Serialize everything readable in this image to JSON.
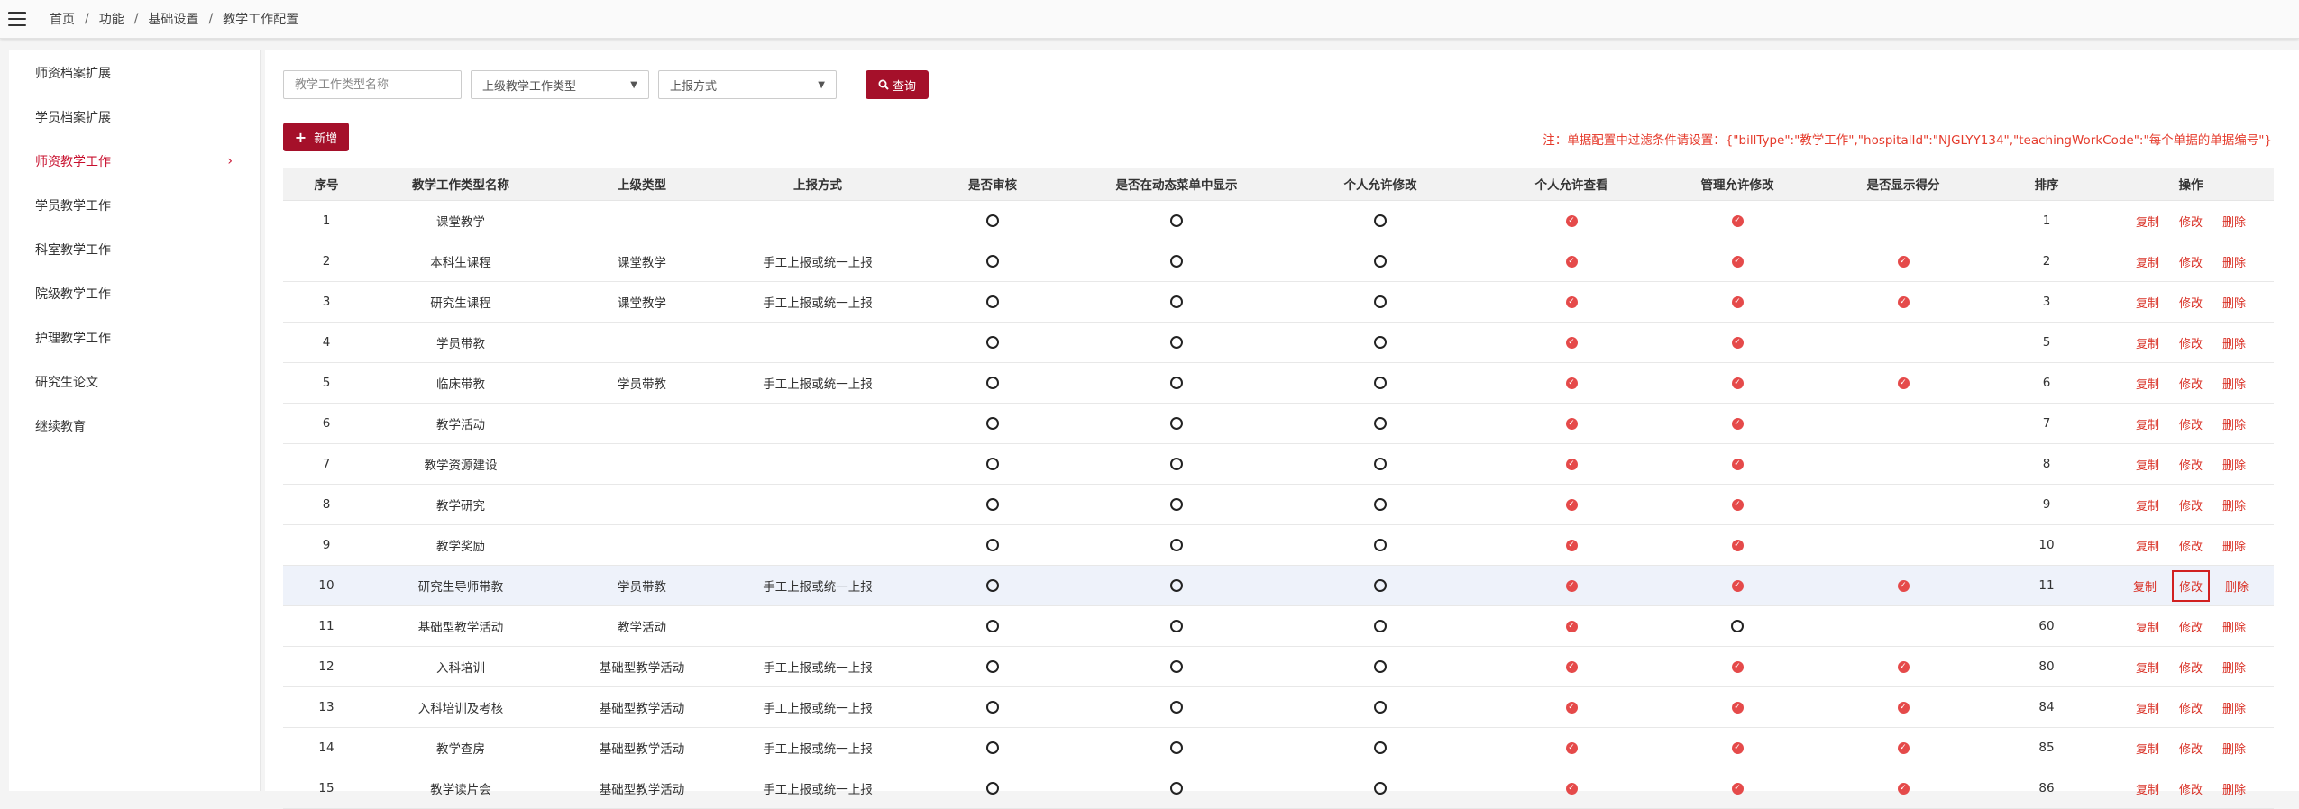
{
  "breadcrumb": [
    "首页",
    "功能",
    "基础设置",
    "教学工作配置"
  ],
  "sidebar": {
    "items": [
      {
        "label": "师资档案扩展",
        "active": false
      },
      {
        "label": "学员档案扩展",
        "active": false
      },
      {
        "label": "师资教学工作",
        "active": true
      },
      {
        "label": "学员教学工作",
        "active": false
      },
      {
        "label": "科室教学工作",
        "active": false
      },
      {
        "label": "院级教学工作",
        "active": false
      },
      {
        "label": "护理教学工作",
        "active": false
      },
      {
        "label": "研究生论文",
        "active": false
      },
      {
        "label": "继续教育",
        "active": false
      }
    ],
    "active_chevron": "›"
  },
  "filters": {
    "name_placeholder": "教学工作类型名称",
    "parent_type": "上级教学工作类型",
    "report_method": "上报方式",
    "query_label": "查询"
  },
  "add_label": "新增",
  "note": "注：单据配置中过滤条件请设置：{\"billType\":\"教学工作\",\"hospitalId\":\"NJGLYY134\",\"teachingWorkCode\":\"每个单据的单据编号\"}",
  "columns": [
    "序号",
    "教学工作类型名称",
    "上级类型",
    "上报方式",
    "是否审核",
    "是否在动态菜单中显示",
    "个人允许修改",
    "个人允许查看",
    "管理允许修改",
    "是否显示得分",
    "排序",
    "操作"
  ],
  "actions": {
    "copy": "复制",
    "edit": "修改",
    "delete": "删除"
  },
  "rows": [
    {
      "no": "1",
      "name": "课堂教学",
      "parent": "",
      "report": "",
      "audit": false,
      "menu": false,
      "self_edit": false,
      "self_view": true,
      "admin_edit": true,
      "score": null,
      "sort": "1"
    },
    {
      "no": "2",
      "name": "本科生课程",
      "parent": "课堂教学",
      "report": "手工上报或统一上报",
      "audit": false,
      "menu": false,
      "self_edit": false,
      "self_view": true,
      "admin_edit": true,
      "score": true,
      "sort": "2"
    },
    {
      "no": "3",
      "name": "研究生课程",
      "parent": "课堂教学",
      "report": "手工上报或统一上报",
      "audit": false,
      "menu": false,
      "self_edit": false,
      "self_view": true,
      "admin_edit": true,
      "score": true,
      "sort": "3"
    },
    {
      "no": "4",
      "name": "学员带教",
      "parent": "",
      "report": "",
      "audit": false,
      "menu": false,
      "self_edit": false,
      "self_view": true,
      "admin_edit": true,
      "score": null,
      "sort": "5"
    },
    {
      "no": "5",
      "name": "临床带教",
      "parent": "学员带教",
      "report": "手工上报或统一上报",
      "audit": false,
      "menu": false,
      "self_edit": false,
      "self_view": true,
      "admin_edit": true,
      "score": true,
      "sort": "6"
    },
    {
      "no": "6",
      "name": "教学活动",
      "parent": "",
      "report": "",
      "audit": false,
      "menu": false,
      "self_edit": false,
      "self_view": true,
      "admin_edit": true,
      "score": null,
      "sort": "7"
    },
    {
      "no": "7",
      "name": "教学资源建设",
      "parent": "",
      "report": "",
      "audit": false,
      "menu": false,
      "self_edit": false,
      "self_view": true,
      "admin_edit": true,
      "score": null,
      "sort": "8"
    },
    {
      "no": "8",
      "name": "教学研究",
      "parent": "",
      "report": "",
      "audit": false,
      "menu": false,
      "self_edit": false,
      "self_view": true,
      "admin_edit": true,
      "score": null,
      "sort": "9"
    },
    {
      "no": "9",
      "name": "教学奖励",
      "parent": "",
      "report": "",
      "audit": false,
      "menu": false,
      "self_edit": false,
      "self_view": true,
      "admin_edit": true,
      "score": null,
      "sort": "10"
    },
    {
      "no": "10",
      "name": "研究生导师带教",
      "parent": "学员带教",
      "report": "手工上报或统一上报",
      "audit": false,
      "menu": false,
      "self_edit": false,
      "self_view": true,
      "admin_edit": true,
      "score": true,
      "sort": "11",
      "highlight": true
    },
    {
      "no": "11",
      "name": "基础型教学活动",
      "parent": "教学活动",
      "report": "",
      "audit": false,
      "menu": false,
      "self_edit": false,
      "self_view": true,
      "admin_edit": false,
      "score": null,
      "sort": "60"
    },
    {
      "no": "12",
      "name": "入科培训",
      "parent": "基础型教学活动",
      "report": "手工上报或统一上报",
      "audit": false,
      "menu": false,
      "self_edit": false,
      "self_view": true,
      "admin_edit": true,
      "score": true,
      "sort": "80"
    },
    {
      "no": "13",
      "name": "入科培训及考核",
      "parent": "基础型教学活动",
      "report": "手工上报或统一上报",
      "audit": false,
      "menu": false,
      "self_edit": false,
      "self_view": true,
      "admin_edit": true,
      "score": true,
      "sort": "84"
    },
    {
      "no": "14",
      "name": "教学查房",
      "parent": "基础型教学活动",
      "report": "手工上报或统一上报",
      "audit": false,
      "menu": false,
      "self_edit": false,
      "self_view": true,
      "admin_edit": true,
      "score": true,
      "sort": "85"
    },
    {
      "no": "15",
      "name": "教学读片会",
      "parent": "基础型教学活动",
      "report": "手工上报或统一上报",
      "audit": false,
      "menu": false,
      "self_edit": false,
      "self_view": true,
      "admin_edit": true,
      "score": true,
      "sort": "86"
    }
  ],
  "colors": {
    "accent": "#a5102a",
    "link_red": "#d93025",
    "check_red": "#e54a4a",
    "highlight_row": "#eef2fa"
  },
  "icons": {
    "menu": "hamburger-icon",
    "search": "search-icon",
    "add": "plus-icon",
    "yes": "check-circle-icon",
    "no": "empty-circle-icon",
    "dropdown": "chevron-down-icon"
  }
}
